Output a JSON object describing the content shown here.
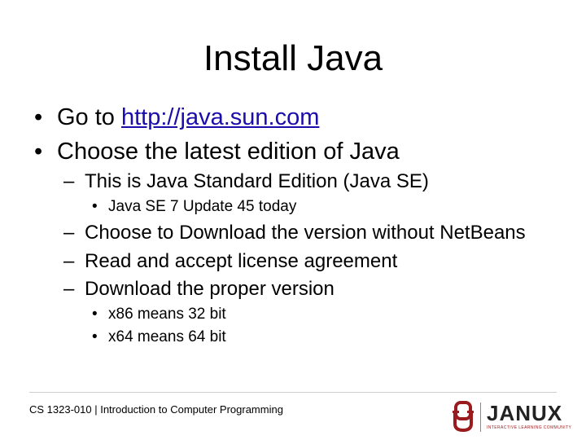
{
  "title": "Install Java",
  "bullets": [
    {
      "level": 1,
      "marker": "•",
      "prefix": "Go to ",
      "link": "http://java.sun.com"
    },
    {
      "level": 1,
      "marker": "•",
      "text": "Choose the latest edition of Java"
    },
    {
      "level": 2,
      "marker": "–",
      "text": "This is Java Standard Edition (Java SE)"
    },
    {
      "level": 3,
      "marker": "•",
      "text": "Java SE 7 Update 45 today"
    },
    {
      "level": 2,
      "marker": "–",
      "text": "Choose to Download the version without NetBeans"
    },
    {
      "level": 2,
      "marker": "–",
      "text": "Read and accept license agreement"
    },
    {
      "level": 2,
      "marker": "–",
      "text": "Download the proper version"
    },
    {
      "level": 3,
      "marker": "•",
      "text": "x86 means 32 bit"
    },
    {
      "level": 3,
      "marker": "•",
      "text": "x64 means 64 bit"
    }
  ],
  "footer": {
    "course": "CS 1323-010 | Introduction to Computer Programming",
    "logo_word": "JANUX",
    "logo_tagline": "INTERACTIVE LEARNING COMMUNITY"
  },
  "colors": {
    "link": "#1a0dab",
    "ou_crimson": "#9a1b1e"
  },
  "icons": {
    "logo_mark": "ou-interlocking-logo-icon"
  }
}
